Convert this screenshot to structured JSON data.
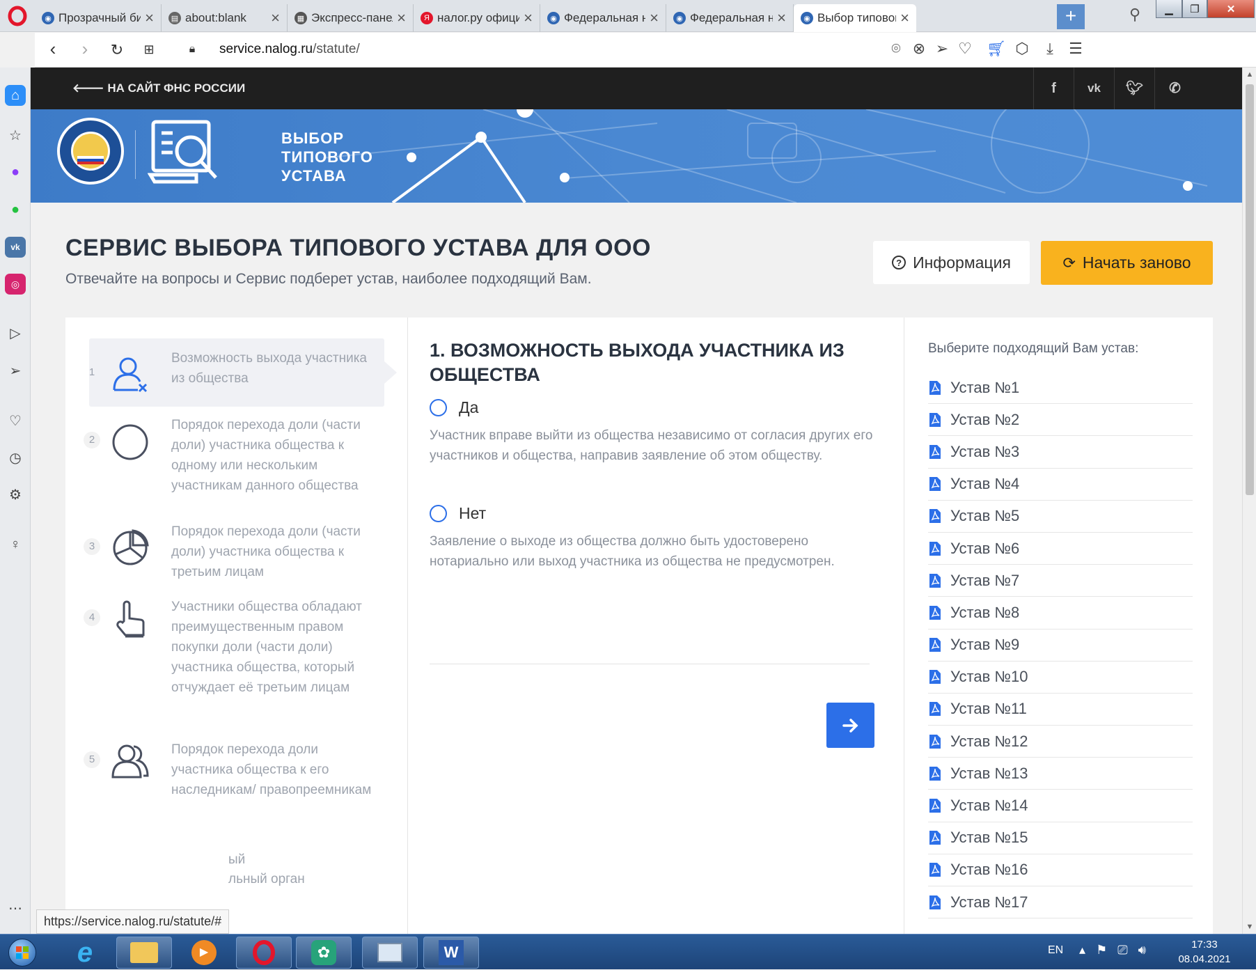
{
  "browser": {
    "tabs": [
      {
        "title": "Прозрачный биз",
        "favicon": "fns-icon"
      },
      {
        "title": "about:blank",
        "favicon": "page-icon"
      },
      {
        "title": "Экспресс-панель",
        "favicon": "grid-icon"
      },
      {
        "title": "налог.ру официа",
        "favicon": "yandex-icon"
      },
      {
        "title": "Федеральная нал",
        "favicon": "fns-icon"
      },
      {
        "title": "Федеральная нал",
        "favicon": "fns-icon"
      },
      {
        "title": "Выбор типового",
        "favicon": "fns-icon",
        "active": true
      }
    ],
    "url_host": "service.nalog.ru",
    "url_path": "/statute/",
    "status_url": "https://service.nalog.ru/statute/#",
    "accent": "#5c8ecc"
  },
  "site": {
    "back_link": "НА САЙТ ФНС РОССИИ",
    "banner_title": [
      "ВЫБОР",
      "ТИПОВОГО",
      "УСТАВА"
    ],
    "social": [
      "f",
      "vk",
      "twitter-icon",
      "phone-icon"
    ]
  },
  "header": {
    "title": "СЕРВИС ВЫБОРА ТИПОВОГО УСТАВА ДЛЯ ООО",
    "subtitle": "Отвечайте на вопросы и Сервис подберет устав, наиболее подходящий Вам.",
    "info_button": "Информация",
    "restart_button": "Начать заново"
  },
  "steps": [
    {
      "num": "1",
      "text": "Возможность выхода участника из общества",
      "icon": "user-remove-icon"
    },
    {
      "num": "2",
      "text": "Порядок перехода доли (части доли) участника общества к одному или нескольким участникам данного общества",
      "icon": "circle-icon"
    },
    {
      "num": "3",
      "text": "Порядок перехода доли (части доли) участника общества к третьим лицам",
      "icon": "pie-chart-icon"
    },
    {
      "num": "4",
      "text": "Участники общества обладают преимущественным правом покупки доли (части доли) участника общества, который отчуждает её третьим лицам",
      "icon": "hand-pointer-icon"
    },
    {
      "num": "5",
      "text": "Порядок перехода доли участника общества к его наследникам/ правопреемникам",
      "icon": "users-icon"
    },
    {
      "num": "",
      "text": "ый",
      "text2": "льный орган",
      "icon": ""
    }
  ],
  "question": {
    "title": "1. ВОЗМОЖНОСТЬ ВЫХОДА УЧАСТНИКА ИЗ ОБЩЕСТВА",
    "options": [
      {
        "label": "Да",
        "description": "Участник вправе выйти из общества независимо от согласия других его участников и общества, направив заявление об этом обществу."
      },
      {
        "label": "Нет",
        "description": "Заявление о выходе из общества должно быть удостоверено нотариально или выход участника из общества не предусмотрен."
      }
    ],
    "accent": "#2c6fe8"
  },
  "statutes": {
    "title": "Выберите подходящий Вам устав:",
    "items": [
      "Устав №1",
      "Устав №2",
      "Устав №3",
      "Устав №4",
      "Устав №5",
      "Устав №6",
      "Устав №7",
      "Устав №8",
      "Устав №9",
      "Устав №10",
      "Устав №11",
      "Устав №12",
      "Устав №13",
      "Устав №14",
      "Устав №15",
      "Устав №16",
      "Устав №17"
    ]
  },
  "taskbar": {
    "lang": "EN",
    "time": "17:33",
    "date": "08.04.2021"
  }
}
